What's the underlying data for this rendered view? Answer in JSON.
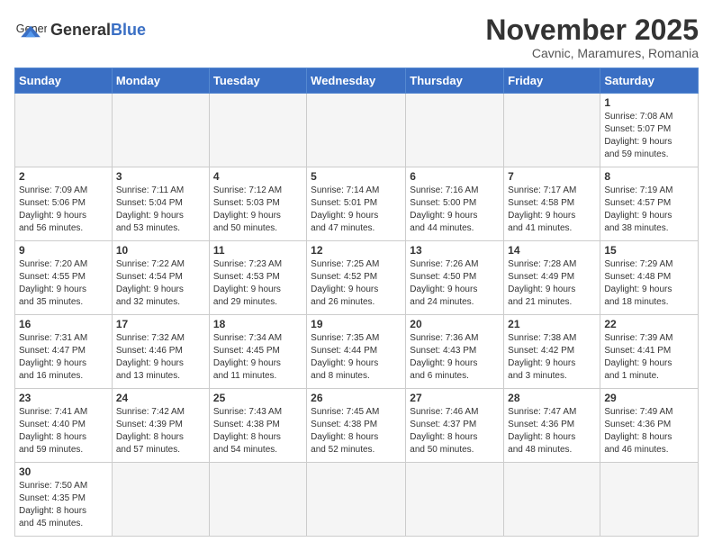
{
  "header": {
    "logo_general": "General",
    "logo_blue": "Blue",
    "month_title": "November 2025",
    "subtitle": "Cavnic, Maramures, Romania"
  },
  "weekdays": [
    "Sunday",
    "Monday",
    "Tuesday",
    "Wednesday",
    "Thursday",
    "Friday",
    "Saturday"
  ],
  "weeks": [
    [
      {
        "day": "",
        "info": ""
      },
      {
        "day": "",
        "info": ""
      },
      {
        "day": "",
        "info": ""
      },
      {
        "day": "",
        "info": ""
      },
      {
        "day": "",
        "info": ""
      },
      {
        "day": "",
        "info": ""
      },
      {
        "day": "1",
        "info": "Sunrise: 7:08 AM\nSunset: 5:07 PM\nDaylight: 9 hours\nand 59 minutes."
      }
    ],
    [
      {
        "day": "2",
        "info": "Sunrise: 7:09 AM\nSunset: 5:06 PM\nDaylight: 9 hours\nand 56 minutes."
      },
      {
        "day": "3",
        "info": "Sunrise: 7:11 AM\nSunset: 5:04 PM\nDaylight: 9 hours\nand 53 minutes."
      },
      {
        "day": "4",
        "info": "Sunrise: 7:12 AM\nSunset: 5:03 PM\nDaylight: 9 hours\nand 50 minutes."
      },
      {
        "day": "5",
        "info": "Sunrise: 7:14 AM\nSunset: 5:01 PM\nDaylight: 9 hours\nand 47 minutes."
      },
      {
        "day": "6",
        "info": "Sunrise: 7:16 AM\nSunset: 5:00 PM\nDaylight: 9 hours\nand 44 minutes."
      },
      {
        "day": "7",
        "info": "Sunrise: 7:17 AM\nSunset: 4:58 PM\nDaylight: 9 hours\nand 41 minutes."
      },
      {
        "day": "8",
        "info": "Sunrise: 7:19 AM\nSunset: 4:57 PM\nDaylight: 9 hours\nand 38 minutes."
      }
    ],
    [
      {
        "day": "9",
        "info": "Sunrise: 7:20 AM\nSunset: 4:55 PM\nDaylight: 9 hours\nand 35 minutes."
      },
      {
        "day": "10",
        "info": "Sunrise: 7:22 AM\nSunset: 4:54 PM\nDaylight: 9 hours\nand 32 minutes."
      },
      {
        "day": "11",
        "info": "Sunrise: 7:23 AM\nSunset: 4:53 PM\nDaylight: 9 hours\nand 29 minutes."
      },
      {
        "day": "12",
        "info": "Sunrise: 7:25 AM\nSunset: 4:52 PM\nDaylight: 9 hours\nand 26 minutes."
      },
      {
        "day": "13",
        "info": "Sunrise: 7:26 AM\nSunset: 4:50 PM\nDaylight: 9 hours\nand 24 minutes."
      },
      {
        "day": "14",
        "info": "Sunrise: 7:28 AM\nSunset: 4:49 PM\nDaylight: 9 hours\nand 21 minutes."
      },
      {
        "day": "15",
        "info": "Sunrise: 7:29 AM\nSunset: 4:48 PM\nDaylight: 9 hours\nand 18 minutes."
      }
    ],
    [
      {
        "day": "16",
        "info": "Sunrise: 7:31 AM\nSunset: 4:47 PM\nDaylight: 9 hours\nand 16 minutes."
      },
      {
        "day": "17",
        "info": "Sunrise: 7:32 AM\nSunset: 4:46 PM\nDaylight: 9 hours\nand 13 minutes."
      },
      {
        "day": "18",
        "info": "Sunrise: 7:34 AM\nSunset: 4:45 PM\nDaylight: 9 hours\nand 11 minutes."
      },
      {
        "day": "19",
        "info": "Sunrise: 7:35 AM\nSunset: 4:44 PM\nDaylight: 9 hours\nand 8 minutes."
      },
      {
        "day": "20",
        "info": "Sunrise: 7:36 AM\nSunset: 4:43 PM\nDaylight: 9 hours\nand 6 minutes."
      },
      {
        "day": "21",
        "info": "Sunrise: 7:38 AM\nSunset: 4:42 PM\nDaylight: 9 hours\nand 3 minutes."
      },
      {
        "day": "22",
        "info": "Sunrise: 7:39 AM\nSunset: 4:41 PM\nDaylight: 9 hours\nand 1 minute."
      }
    ],
    [
      {
        "day": "23",
        "info": "Sunrise: 7:41 AM\nSunset: 4:40 PM\nDaylight: 8 hours\nand 59 minutes."
      },
      {
        "day": "24",
        "info": "Sunrise: 7:42 AM\nSunset: 4:39 PM\nDaylight: 8 hours\nand 57 minutes."
      },
      {
        "day": "25",
        "info": "Sunrise: 7:43 AM\nSunset: 4:38 PM\nDaylight: 8 hours\nand 54 minutes."
      },
      {
        "day": "26",
        "info": "Sunrise: 7:45 AM\nSunset: 4:38 PM\nDaylight: 8 hours\nand 52 minutes."
      },
      {
        "day": "27",
        "info": "Sunrise: 7:46 AM\nSunset: 4:37 PM\nDaylight: 8 hours\nand 50 minutes."
      },
      {
        "day": "28",
        "info": "Sunrise: 7:47 AM\nSunset: 4:36 PM\nDaylight: 8 hours\nand 48 minutes."
      },
      {
        "day": "29",
        "info": "Sunrise: 7:49 AM\nSunset: 4:36 PM\nDaylight: 8 hours\nand 46 minutes."
      }
    ],
    [
      {
        "day": "30",
        "info": "Sunrise: 7:50 AM\nSunset: 4:35 PM\nDaylight: 8 hours\nand 45 minutes."
      },
      {
        "day": "",
        "info": ""
      },
      {
        "day": "",
        "info": ""
      },
      {
        "day": "",
        "info": ""
      },
      {
        "day": "",
        "info": ""
      },
      {
        "day": "",
        "info": ""
      },
      {
        "day": "",
        "info": ""
      }
    ]
  ]
}
